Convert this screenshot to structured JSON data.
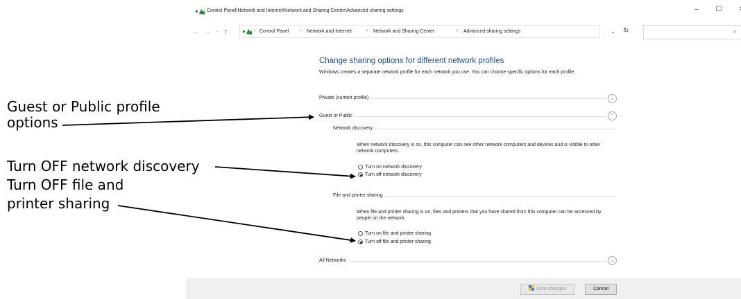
{
  "window": {
    "title": "Control Panel\\Network and Internet\\Network and Sharing Center\\Advanced sharing settings",
    "minimize": "–",
    "maximize": "☐",
    "close": "✕"
  },
  "nav": {
    "back": "←",
    "forward": "→",
    "recent": "⌄",
    "up": "↑",
    "breadcrumbs": [
      "Control Panel",
      "Network and Internet",
      "Network and Sharing Center",
      "Advanced sharing settings"
    ],
    "sep": "›",
    "dropdown": "⌄",
    "refresh": "↻",
    "search_placeholder": "",
    "search_icon": "⌕"
  },
  "main": {
    "heading": "Change sharing options for different network profiles",
    "description": "Windows creates a separate network profile for each network you use. You can choose specific options for each profile.",
    "profiles": {
      "private": "Private (current profile)",
      "guest": "Guest or Public",
      "all": "All Networks"
    },
    "chevron_down": "⌄",
    "chevron_up": "⌃",
    "network_discovery": {
      "title": "Network discovery",
      "text": "When network discovery is on, this computer can see other network computers and devices and is visible to other network computers.",
      "options": [
        "Turn on network discovery",
        "Turn off network discovery"
      ],
      "selected": 1
    },
    "file_sharing": {
      "title": "File and printer sharing",
      "text": "When file and printer sharing is on, files and printers that you have shared from this computer can be accessed by people on the network.",
      "options": [
        "Turn on file and printer sharing",
        "Turn off file and printer sharing"
      ],
      "selected": 1
    }
  },
  "footer": {
    "save_label": "Save changes",
    "cancel_label": "Cancel"
  },
  "annotations": {
    "guest_line1": "Guest or Public profile",
    "guest_line2": "options",
    "discovery": "Turn OFF network discovery",
    "sharing_line1": "Turn OFF file and",
    "sharing_line2": "printer sharing"
  },
  "colors": {
    "heading": "#1e4e9e",
    "footer_bg": "#f0f0f0"
  }
}
